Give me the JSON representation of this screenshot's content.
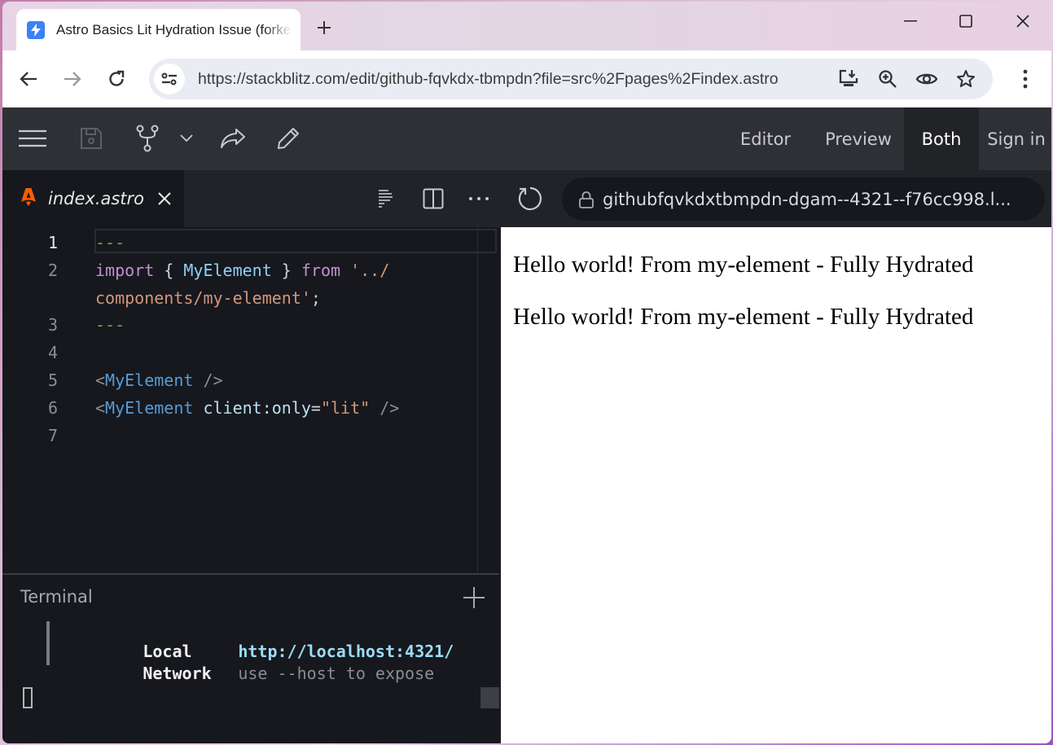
{
  "browser": {
    "tab": {
      "title": "Astro Basics Lit Hydration Issue (forked)",
      "favicon": "stackblitz-bolt-icon",
      "favicon_color": "#3b82f6"
    },
    "new_tab_label": "+",
    "window_controls": [
      "minimize",
      "maximize",
      "close"
    ],
    "address_bar": {
      "url": "https://stackblitz.com/edit/github-fqvkdx-tbmpdn?file=src%2Fpages%2Findex.astro"
    },
    "omnibox_icons": [
      "install-app-icon",
      "zoom-icon",
      "eye-icon",
      "bookmark-star-icon"
    ]
  },
  "stackblitz": {
    "header": {
      "icons": [
        "hamburger-menu-icon",
        "save-icon",
        "fork-icon",
        "chevron-down-icon",
        "share-icon",
        "edit-pencil-icon"
      ],
      "views": [
        {
          "label": "Editor",
          "active": false
        },
        {
          "label": "Preview",
          "active": false
        },
        {
          "label": "Both",
          "active": true
        }
      ],
      "sign_in_label": "Sign in"
    },
    "editor": {
      "open_file": {
        "name": "index.astro",
        "icon": "astro-logo-icon",
        "icon_color": "#ff5d01"
      },
      "actions": [
        "prettier-icon",
        "split-editor-icon",
        "more-icon"
      ],
      "current_line": 1,
      "lines": [
        {
          "number": "1",
          "tokens": [
            {
              "t": "---",
              "k": "frontmatter"
            }
          ]
        },
        {
          "number": "2",
          "tokens": [
            {
              "t": "import",
              "k": "keyword"
            },
            {
              "t": " { ",
              "k": "punct"
            },
            {
              "t": "MyElement",
              "k": "ident"
            },
            {
              "t": " } ",
              "k": "punct"
            },
            {
              "t": "from",
              "k": "keyword"
            },
            {
              "t": " '../",
              "k": "string"
            }
          ]
        },
        {
          "number": "",
          "tokens": [
            {
              "t": "components/my-element'",
              "k": "string"
            },
            {
              "t": ";",
              "k": "punct"
            }
          ]
        },
        {
          "number": "3",
          "tokens": [
            {
              "t": "---",
              "k": "frontmatter"
            }
          ]
        },
        {
          "number": "4",
          "tokens": []
        },
        {
          "number": "5",
          "tokens": [
            {
              "t": "<",
              "k": "tag-bracket"
            },
            {
              "t": "MyElement",
              "k": "component"
            },
            {
              "t": " />",
              "k": "tag-bracket"
            }
          ]
        },
        {
          "number": "6",
          "tokens": [
            {
              "t": "<",
              "k": "tag-bracket"
            },
            {
              "t": "MyElement",
              "k": "component"
            },
            {
              "t": " ",
              "k": "punct"
            },
            {
              "t": "client:only",
              "k": "attr"
            },
            {
              "t": "=",
              "k": "punct"
            },
            {
              "t": "\"lit\"",
              "k": "string"
            },
            {
              "t": " />",
              "k": "tag-bracket"
            }
          ]
        },
        {
          "number": "7",
          "tokens": []
        }
      ]
    },
    "terminal": {
      "title": "Terminal",
      "rows": [
        {
          "label": "Local",
          "value": "http://localhost:4321/",
          "kind": "url"
        },
        {
          "label": "Network",
          "value": "use --host to expose",
          "kind": "hint"
        }
      ]
    },
    "preview": {
      "url": "githubfqvkdxtbmpdn-dgam--4321--f76cc998.l...",
      "content": [
        "Hello world! From my-element - Fully Hydrated",
        "Hello world! From my-element - Fully Hydrated"
      ]
    }
  }
}
